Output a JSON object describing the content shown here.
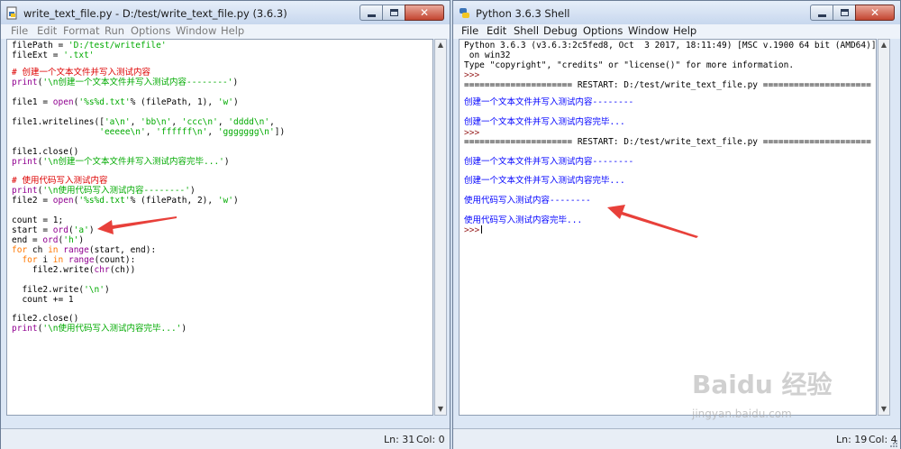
{
  "editor": {
    "title": "write_text_file.py - D:/test/write_text_file.py (3.6.3)",
    "menu": [
      "File",
      "Edit",
      "Format",
      "Run",
      "Options",
      "Window",
      "Help"
    ],
    "code": [
      [
        [
          "",
          "filePath = "
        ],
        [
          "st",
          "'D:/test/writefile'"
        ]
      ],
      [
        [
          "",
          "fileExt = "
        ],
        [
          "st",
          "'.txt'"
        ]
      ],
      [
        [
          "cm",
          "# 创建一个文本文件并写入测试内容"
        ]
      ],
      [
        [
          "bi",
          "print"
        ],
        [
          "",
          "("
        ],
        [
          "st",
          "'\\n创建一个文本文件并写入测试内容--------'"
        ],
        [
          "",
          ")"
        ]
      ],
      [
        [
          "",
          "file1 = "
        ],
        [
          "bi",
          "open"
        ],
        [
          "",
          "("
        ],
        [
          "st",
          "'%s%d.txt'"
        ],
        [
          "",
          "% (filePath, 1), "
        ],
        [
          "st",
          "'w'"
        ],
        [
          "",
          ")"
        ]
      ],
      [
        [
          "",
          "file1.writelines(["
        ],
        [
          "st",
          "'a\\n'"
        ],
        [
          "",
          ", "
        ],
        [
          "st",
          "'bb\\n'"
        ],
        [
          "",
          ", "
        ],
        [
          "st",
          "'ccc\\n'"
        ],
        [
          "",
          ", "
        ],
        [
          "st",
          "'dddd\\n'"
        ],
        [
          "",
          ","
        ]
      ],
      [
        [
          "",
          "                 "
        ],
        [
          "st",
          "'eeeee\\n'"
        ],
        [
          "",
          ", "
        ],
        [
          "st",
          "'ffffff\\n'"
        ],
        [
          "",
          ", "
        ],
        [
          "st",
          "'ggggggg\\n'"
        ],
        [
          "",
          "])"
        ]
      ],
      [
        [
          "",
          "file1.close()"
        ]
      ],
      [
        [
          "bi",
          "print"
        ],
        [
          "",
          "("
        ],
        [
          "st",
          "'\\n创建一个文本文件并写入测试内容完毕...'"
        ],
        [
          "",
          ")"
        ]
      ],
      [
        [
          "cm",
          "# 使用代码写入测试内容"
        ]
      ],
      [
        [
          "bi",
          "print"
        ],
        [
          "",
          "("
        ],
        [
          "st",
          "'\\n使用代码写入测试内容--------'"
        ],
        [
          "",
          ")"
        ]
      ],
      [
        [
          "",
          "file2 = "
        ],
        [
          "bi",
          "open"
        ],
        [
          "",
          "("
        ],
        [
          "st",
          "'%s%d.txt'"
        ],
        [
          "",
          "% (filePath, 2), "
        ],
        [
          "st",
          "'w'"
        ],
        [
          "",
          ")"
        ]
      ],
      [
        [
          "",
          "count = 1;"
        ]
      ],
      [
        [
          "",
          "start = "
        ],
        [
          "bi",
          "ord"
        ],
        [
          "",
          "("
        ],
        [
          "st",
          "'a'"
        ],
        [
          "",
          ")"
        ]
      ],
      [
        [
          "",
          "end = "
        ],
        [
          "bi",
          "ord"
        ],
        [
          "",
          "("
        ],
        [
          "st",
          "'h'"
        ],
        [
          "",
          ")"
        ]
      ],
      [
        [
          "kw",
          "for"
        ],
        [
          "",
          " ch "
        ],
        [
          "kw",
          "in"
        ],
        [
          "",
          " "
        ],
        [
          "bi",
          "range"
        ],
        [
          "",
          "(start, end):"
        ]
      ],
      [
        [
          "",
          "  "
        ],
        [
          "kw",
          "for"
        ],
        [
          "",
          " i "
        ],
        [
          "kw",
          "in"
        ],
        [
          "",
          " "
        ],
        [
          "bi",
          "range"
        ],
        [
          "",
          "(count):"
        ]
      ],
      [
        [
          "",
          "    file2.write("
        ],
        [
          "bi",
          "chr"
        ],
        [
          "",
          "(ch))"
        ]
      ],
      [
        [
          "",
          "  file2.write("
        ],
        [
          "st",
          "'\\n'"
        ],
        [
          "",
          ")"
        ]
      ],
      [
        [
          "",
          "  count += 1"
        ]
      ],
      [
        [
          "",
          "file2.close()"
        ]
      ],
      [
        [
          "bi",
          "print"
        ],
        [
          "",
          "("
        ],
        [
          "st",
          "'\\n使用代码写入测试内容完毕...'"
        ],
        [
          "",
          ")"
        ]
      ]
    ],
    "status": {
      "line": "Ln: 31",
      "col": "Col: 0"
    }
  },
  "shell": {
    "title": "Python 3.6.3 Shell",
    "menu": [
      "File",
      "Edit",
      "Shell",
      "Debug",
      "Options",
      "Window",
      "Help"
    ],
    "lines": [
      [
        [
          "",
          "Python 3.6.3 (v3.6.3:2c5fed8, Oct  3 2017, 18:11:49) [MSC v.1900 64 bit (AMD64)]"
        ]
      ],
      [
        [
          "",
          " on win32"
        ]
      ],
      [
        [
          "",
          "Type \"copyright\", \"credits\" or \"license()\" for more information."
        ]
      ],
      [
        [
          "pr",
          ">>> "
        ]
      ],
      [
        [
          "",
          "===================== RESTART: D:/test/write_text_file.py ====================="
        ]
      ],
      [
        [
          "ou",
          "创建一个文本文件并写入测试内容--------"
        ]
      ],
      [
        [
          "ou",
          "创建一个文本文件并写入测试内容完毕..."
        ]
      ],
      [
        [
          "pr",
          ">>> "
        ]
      ],
      [
        [
          "",
          "===================== RESTART: D:/test/write_text_file.py ====================="
        ]
      ],
      [
        [
          "ou",
          "创建一个文本文件并写入测试内容--------"
        ]
      ],
      [
        [
          "ou",
          "创建一个文本文件并写入测试内容完毕..."
        ]
      ],
      [
        [
          "ou",
          "使用代码写入测试内容--------"
        ]
      ],
      [
        [
          "ou",
          "使用代码写入测试内容完毕..."
        ]
      ],
      [
        [
          "pr",
          ">>> "
        ]
      ]
    ],
    "status": {
      "line": "Ln: 19",
      "col": "Col: 4"
    }
  },
  "watermark": {
    "logo": "Baidu 经验",
    "url": "jingyan.baidu.com"
  },
  "colors": {
    "keyword": "#ff7700",
    "builtin": "#900090",
    "string": "#00aa00",
    "comment": "#dd0000",
    "output": "#0000ff",
    "prompt": "#992222",
    "annotation_arrow": "#e8403a"
  }
}
